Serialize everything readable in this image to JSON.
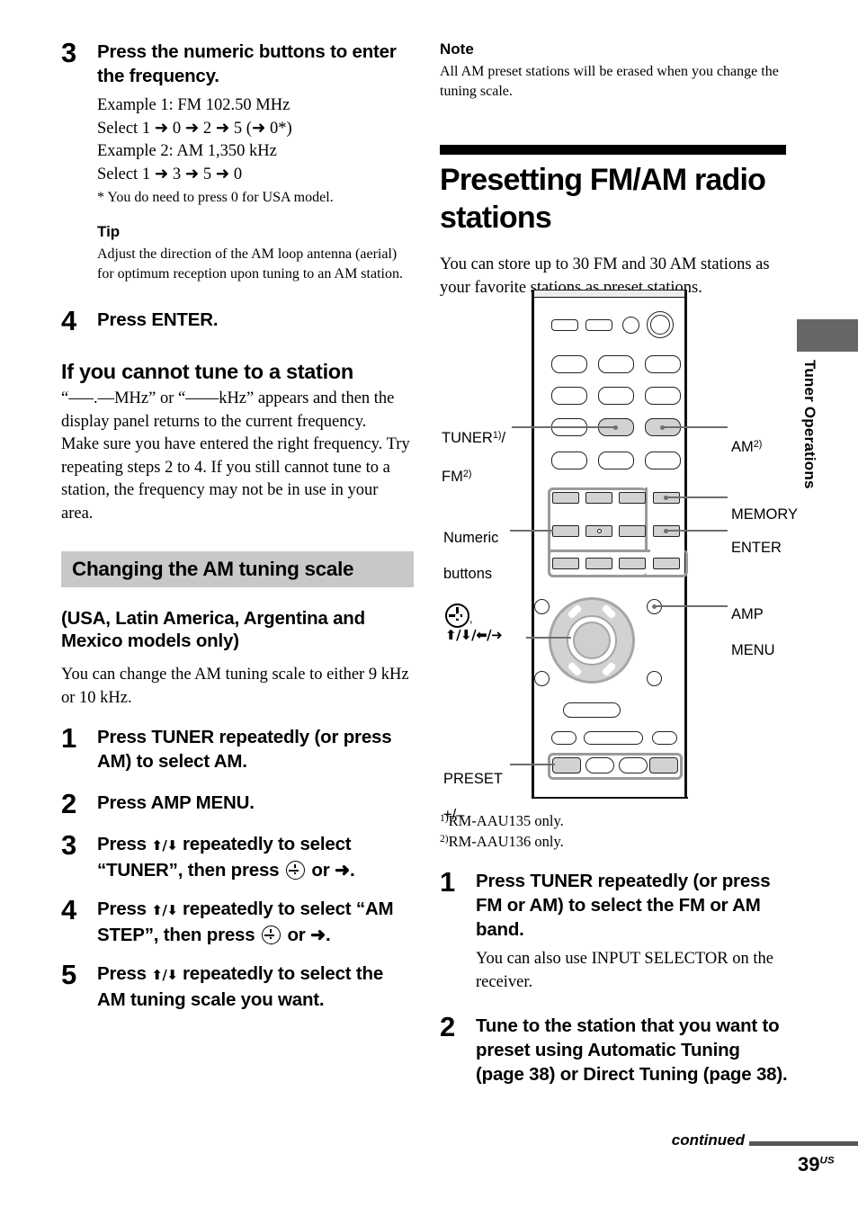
{
  "page": {
    "number": "39",
    "region_suffix": "US",
    "continued_label": "continued",
    "side_tab_label": "Tuner Operations",
    "band_color": "#c8c8c8",
    "tab_color": "#666666"
  },
  "left_column": {
    "step3": {
      "number": "3",
      "title": "Press the numeric buttons to enter the frequency.",
      "lines": [
        "Example 1: FM 102.50 MHz",
        "Select 1 ➜ 0 ➜ 2 ➜ 5 (➜ 0*)",
        "Example 2: AM 1,350 kHz",
        "Select 1 ➜ 3 ➜ 5 ➜ 0"
      ],
      "footnote": "* You do need to press 0 for USA model."
    },
    "tip": {
      "heading": "Tip",
      "text": "Adjust the direction of the AM loop antenna (aerial) for optimum reception upon tuning to an AM station."
    },
    "step4": {
      "number": "4",
      "title": "Press ENTER."
    },
    "cannot_tune": {
      "heading": "If you cannot tune to a station",
      "paragraph1": "“–––.––MHz” or “––––kHz” appears and then the display panel returns to the current frequency.",
      "paragraph2": "Make sure you have entered the right frequency. Try repeating steps 2 to 4. If you still cannot tune to a station, the frequency may not be in use in your area."
    },
    "am_scale_section": {
      "band_heading": "Changing the AM tuning scale",
      "models_heading": "(USA, Latin America, Argentina and Mexico models only)",
      "intro": "You can change the AM tuning scale to either 9 kHz or 10 kHz.",
      "steps": [
        {
          "number": "1",
          "title": "Press TUNER repeatedly (or press AM) to select AM."
        },
        {
          "number": "2",
          "title": "Press AMP MENU."
        },
        {
          "number": "3",
          "title_pre": "Press ",
          "arrows": "⬆/⬇",
          "title_mid": " repeatedly to select “TUNER”, then press ",
          "title_post": " or ➜."
        },
        {
          "number": "4",
          "title_pre": "Press ",
          "arrows": "⬆/⬇",
          "title_mid": " repeatedly to select “AM STEP”, then press ",
          "title_post": " or ➜."
        },
        {
          "number": "5",
          "title_pre": "Press ",
          "arrows": "⬆/⬇",
          "title_mid": " repeatedly to select the AM tuning scale you want.",
          "title_post": ""
        }
      ]
    }
  },
  "right_column": {
    "note": {
      "heading": "Note",
      "text": "All AM preset stations will be erased when you change the tuning scale."
    },
    "main_heading": "Presetting FM/AM radio stations",
    "intro": "You can store up to 30 FM and 30 AM stations as your favorite stations as preset stations.",
    "footnotes": [
      {
        "marker": "1)",
        "text": "RM-AAU135 only."
      },
      {
        "marker": "2)",
        "text": "RM-AAU136 only."
      }
    ],
    "step1": {
      "number": "1",
      "title": "Press TUNER repeatedly (or press FM or AM) to select the FM or AM band.",
      "detail": "You can also use INPUT SELECTOR on the receiver."
    },
    "step2": {
      "number": "2",
      "title": "Tune to the station that you want to preset using Automatic Tuning (page 38) or Direct Tuning (page 38)."
    }
  },
  "remote_diagram": {
    "callouts": {
      "tuner_fm": "TUNER1)/\nFM2)",
      "tuner_fm_main": "TUNER",
      "tuner_fm_sup1": "1)",
      "tuner_fm_slash": "/",
      "tuner_fm_second": "FM",
      "tuner_fm_sup2": "2)",
      "am": "AM",
      "am_sup": "2)",
      "memory": "MEMORY",
      "enter": "ENTER",
      "amp_menu": "AMP\nMENU",
      "amp_menu_line1": "AMP",
      "amp_menu_line2": "MENU",
      "numeric_buttons_line1": "Numeric",
      "numeric_buttons_line2": "buttons",
      "nav_arrows": "⬆/⬇/⬅/➜",
      "nav_comma": ",",
      "preset_line1": "PRESET",
      "preset_line2": "+/–"
    }
  }
}
